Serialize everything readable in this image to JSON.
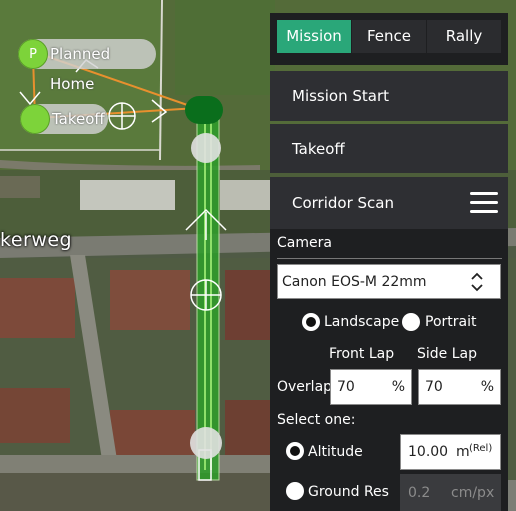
{
  "map": {
    "street_label": "kerweg",
    "planned_home": {
      "badge": "P",
      "label": "Planned Home"
    },
    "takeoff": {
      "label": "Takeoff"
    }
  },
  "tabs": [
    {
      "label": "Mission",
      "active": true
    },
    {
      "label": "Fence",
      "active": false
    },
    {
      "label": "Rally",
      "active": false
    }
  ],
  "items": {
    "mission_start": "Mission Start",
    "takeoff": "Takeoff",
    "corridor_scan": "Corridor Scan"
  },
  "camera": {
    "section_label": "Camera",
    "selected": "Canon EOS-M 22mm",
    "orientation": {
      "landscape": "Landscape",
      "portrait": "Portrait",
      "selected": "landscape"
    },
    "front_lap_label": "Front Lap",
    "side_lap_label": "Side Lap",
    "overlap_label": "Overlap",
    "front_lap_value": "70",
    "side_lap_value": "70",
    "percent_unit": "%",
    "select_one_label": "Select one:",
    "altitude_label": "Altitude",
    "altitude_value": "10.00",
    "altitude_unit": "m",
    "altitude_ref": "(Rel)",
    "ground_res_label": "Ground Res",
    "ground_res_value": "0.2",
    "ground_res_unit": "cm/px",
    "mode_selected": "altitude"
  },
  "colors": {
    "accent": "#2aa779",
    "path_orange": "#e8902e",
    "corridor_green": "#2e9e2a",
    "marker_green": "#7dd33a",
    "dark_green": "#0a6e1c"
  }
}
